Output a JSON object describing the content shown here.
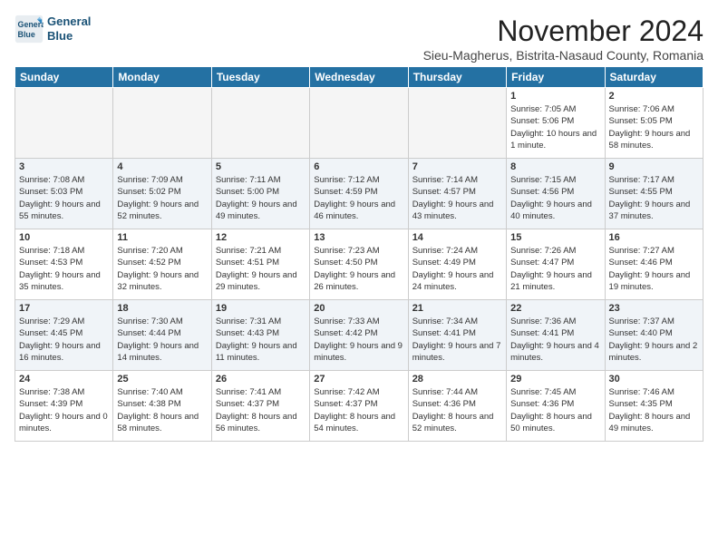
{
  "logo": {
    "line1": "General",
    "line2": "Blue"
  },
  "title": "November 2024",
  "subtitle": "Sieu-Magherus, Bistrita-Nasaud County, Romania",
  "weekdays": [
    "Sunday",
    "Monday",
    "Tuesday",
    "Wednesday",
    "Thursday",
    "Friday",
    "Saturday"
  ],
  "weeks": [
    [
      {
        "day": "",
        "info": ""
      },
      {
        "day": "",
        "info": ""
      },
      {
        "day": "",
        "info": ""
      },
      {
        "day": "",
        "info": ""
      },
      {
        "day": "",
        "info": ""
      },
      {
        "day": "1",
        "info": "Sunrise: 7:05 AM\nSunset: 5:06 PM\nDaylight: 10 hours and 1 minute."
      },
      {
        "day": "2",
        "info": "Sunrise: 7:06 AM\nSunset: 5:05 PM\nDaylight: 9 hours and 58 minutes."
      }
    ],
    [
      {
        "day": "3",
        "info": "Sunrise: 7:08 AM\nSunset: 5:03 PM\nDaylight: 9 hours and 55 minutes."
      },
      {
        "day": "4",
        "info": "Sunrise: 7:09 AM\nSunset: 5:02 PM\nDaylight: 9 hours and 52 minutes."
      },
      {
        "day": "5",
        "info": "Sunrise: 7:11 AM\nSunset: 5:00 PM\nDaylight: 9 hours and 49 minutes."
      },
      {
        "day": "6",
        "info": "Sunrise: 7:12 AM\nSunset: 4:59 PM\nDaylight: 9 hours and 46 minutes."
      },
      {
        "day": "7",
        "info": "Sunrise: 7:14 AM\nSunset: 4:57 PM\nDaylight: 9 hours and 43 minutes."
      },
      {
        "day": "8",
        "info": "Sunrise: 7:15 AM\nSunset: 4:56 PM\nDaylight: 9 hours and 40 minutes."
      },
      {
        "day": "9",
        "info": "Sunrise: 7:17 AM\nSunset: 4:55 PM\nDaylight: 9 hours and 37 minutes."
      }
    ],
    [
      {
        "day": "10",
        "info": "Sunrise: 7:18 AM\nSunset: 4:53 PM\nDaylight: 9 hours and 35 minutes."
      },
      {
        "day": "11",
        "info": "Sunrise: 7:20 AM\nSunset: 4:52 PM\nDaylight: 9 hours and 32 minutes."
      },
      {
        "day": "12",
        "info": "Sunrise: 7:21 AM\nSunset: 4:51 PM\nDaylight: 9 hours and 29 minutes."
      },
      {
        "day": "13",
        "info": "Sunrise: 7:23 AM\nSunset: 4:50 PM\nDaylight: 9 hours and 26 minutes."
      },
      {
        "day": "14",
        "info": "Sunrise: 7:24 AM\nSunset: 4:49 PM\nDaylight: 9 hours and 24 minutes."
      },
      {
        "day": "15",
        "info": "Sunrise: 7:26 AM\nSunset: 4:47 PM\nDaylight: 9 hours and 21 minutes."
      },
      {
        "day": "16",
        "info": "Sunrise: 7:27 AM\nSunset: 4:46 PM\nDaylight: 9 hours and 19 minutes."
      }
    ],
    [
      {
        "day": "17",
        "info": "Sunrise: 7:29 AM\nSunset: 4:45 PM\nDaylight: 9 hours and 16 minutes."
      },
      {
        "day": "18",
        "info": "Sunrise: 7:30 AM\nSunset: 4:44 PM\nDaylight: 9 hours and 14 minutes."
      },
      {
        "day": "19",
        "info": "Sunrise: 7:31 AM\nSunset: 4:43 PM\nDaylight: 9 hours and 11 minutes."
      },
      {
        "day": "20",
        "info": "Sunrise: 7:33 AM\nSunset: 4:42 PM\nDaylight: 9 hours and 9 minutes."
      },
      {
        "day": "21",
        "info": "Sunrise: 7:34 AM\nSunset: 4:41 PM\nDaylight: 9 hours and 7 minutes."
      },
      {
        "day": "22",
        "info": "Sunrise: 7:36 AM\nSunset: 4:41 PM\nDaylight: 9 hours and 4 minutes."
      },
      {
        "day": "23",
        "info": "Sunrise: 7:37 AM\nSunset: 4:40 PM\nDaylight: 9 hours and 2 minutes."
      }
    ],
    [
      {
        "day": "24",
        "info": "Sunrise: 7:38 AM\nSunset: 4:39 PM\nDaylight: 9 hours and 0 minutes."
      },
      {
        "day": "25",
        "info": "Sunrise: 7:40 AM\nSunset: 4:38 PM\nDaylight: 8 hours and 58 minutes."
      },
      {
        "day": "26",
        "info": "Sunrise: 7:41 AM\nSunset: 4:37 PM\nDaylight: 8 hours and 56 minutes."
      },
      {
        "day": "27",
        "info": "Sunrise: 7:42 AM\nSunset: 4:37 PM\nDaylight: 8 hours and 54 minutes."
      },
      {
        "day": "28",
        "info": "Sunrise: 7:44 AM\nSunset: 4:36 PM\nDaylight: 8 hours and 52 minutes."
      },
      {
        "day": "29",
        "info": "Sunrise: 7:45 AM\nSunset: 4:36 PM\nDaylight: 8 hours and 50 minutes."
      },
      {
        "day": "30",
        "info": "Sunrise: 7:46 AM\nSunset: 4:35 PM\nDaylight: 8 hours and 49 minutes."
      }
    ]
  ]
}
